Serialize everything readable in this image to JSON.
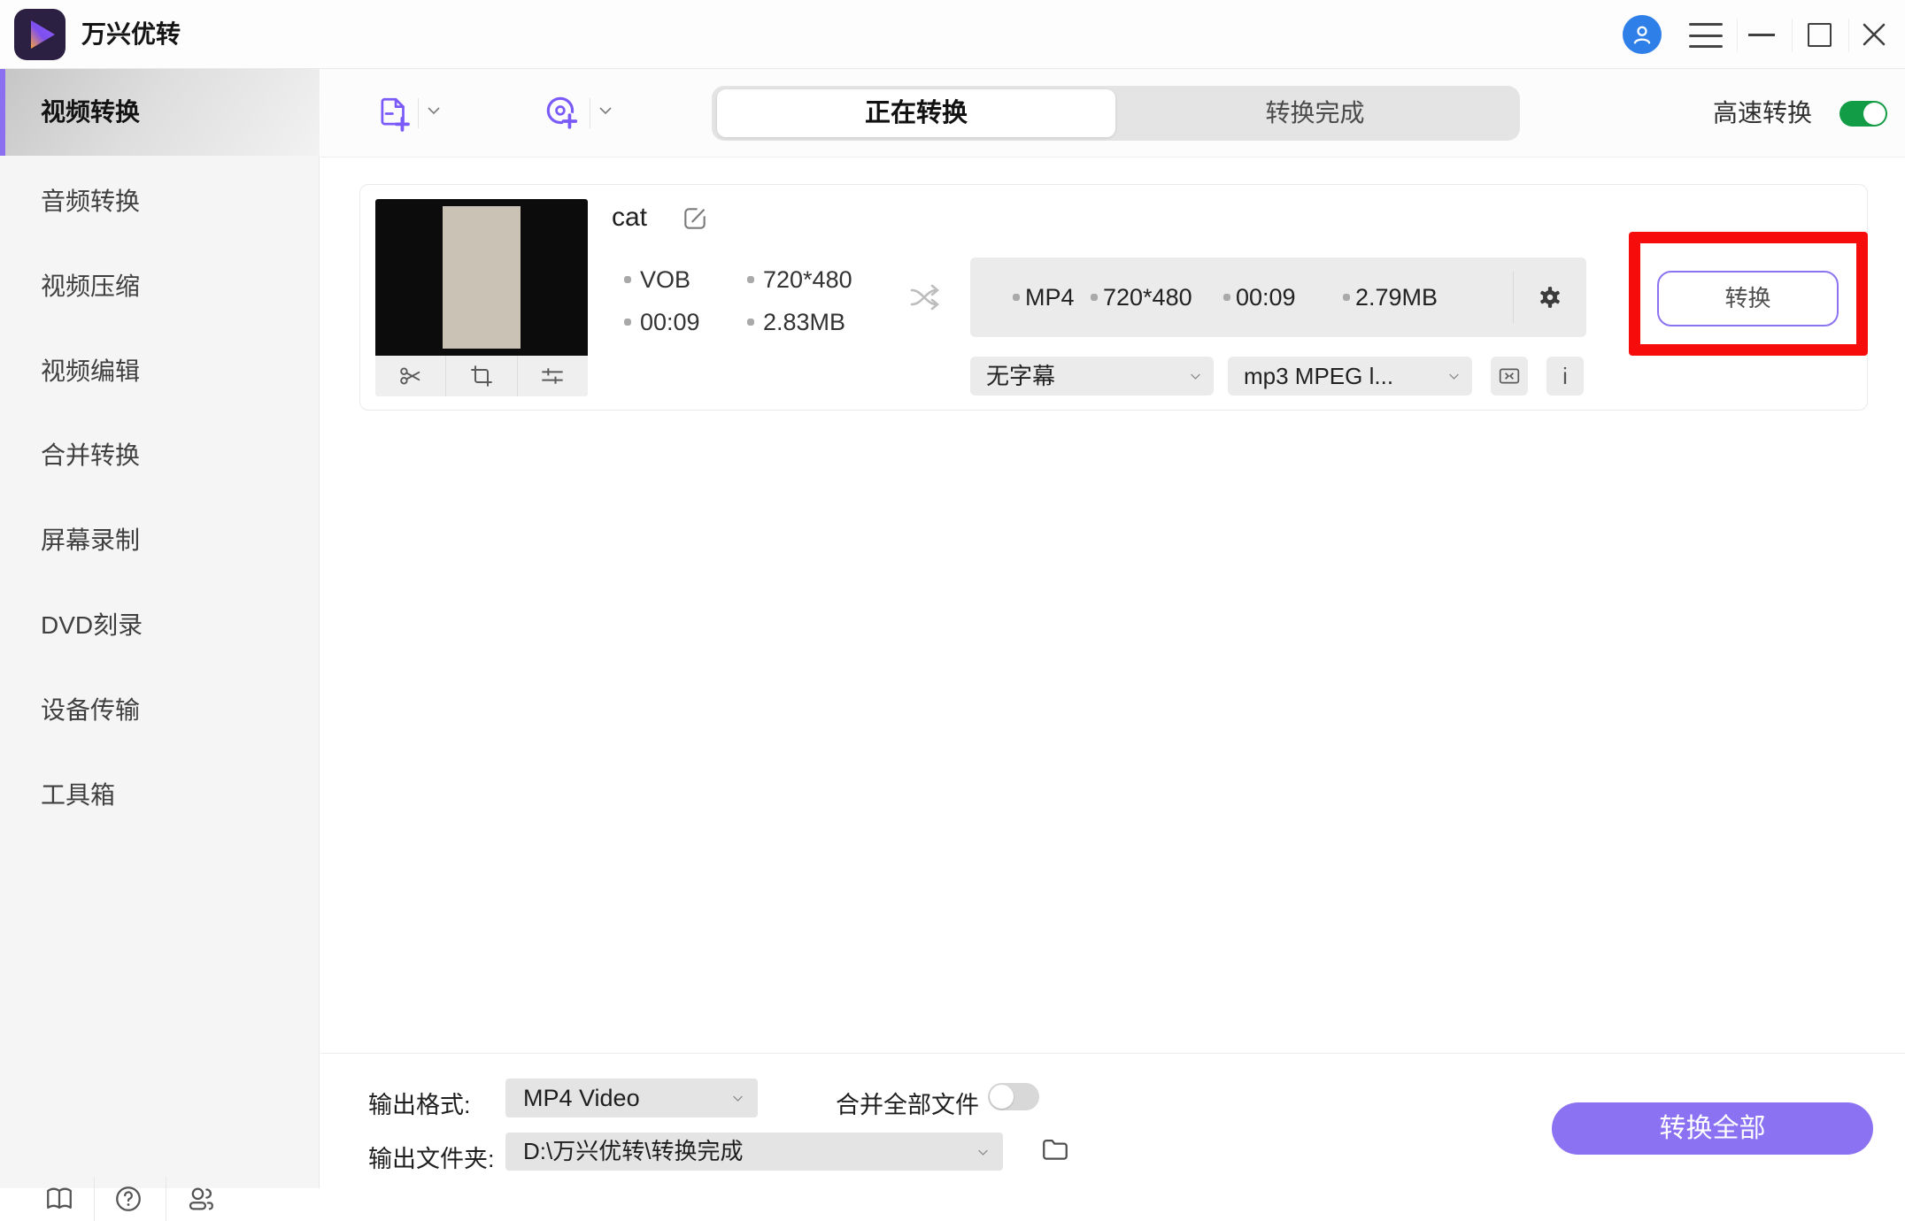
{
  "app": {
    "title": "万兴优转"
  },
  "sidebar": {
    "items": [
      {
        "label": "视频转换",
        "active": true
      },
      {
        "label": "音频转换"
      },
      {
        "label": "视频压缩"
      },
      {
        "label": "视频编辑"
      },
      {
        "label": "合并转换"
      },
      {
        "label": "屏幕录制"
      },
      {
        "label": "DVD刻录"
      },
      {
        "label": "设备传输"
      },
      {
        "label": "工具箱"
      }
    ]
  },
  "toolbar": {
    "tab_converting": "正在转换",
    "tab_finished": "转换完成",
    "high_speed_label": "高速转换",
    "high_speed_on": true
  },
  "task": {
    "name": "cat",
    "source": {
      "format": "VOB",
      "resolution": "720*480",
      "duration": "00:09",
      "size": "2.83MB"
    },
    "output": {
      "format": "MP4",
      "resolution": "720*480",
      "duration": "00:09",
      "size": "2.79MB"
    },
    "subtitle": "无字幕",
    "audio_track": "mp3 MPEG l...",
    "info_glyph": "i",
    "convert_label": "转换"
  },
  "footer": {
    "output_format_label": "输出格式:",
    "output_format_value": "MP4 Video",
    "merge_all_label": "合并全部文件",
    "merge_all_on": false,
    "output_folder_label": "输出文件夹:",
    "output_folder_value": "D:\\万兴优转\\转换完成",
    "convert_all_label": "转换全部"
  },
  "icons": {
    "logo": "play-triangle-gradient",
    "avatar": "person",
    "menu": "hamburger",
    "add_file": "document-plus",
    "add_disc": "disc-plus",
    "thumb_tools": [
      "scissors",
      "crop",
      "sliders"
    ],
    "rename": "pencil-square",
    "transfer": "shuffle-arrows",
    "settings": "gear",
    "trim": "compress-brackets",
    "info": "i",
    "footer_left": [
      "book",
      "help",
      "community"
    ],
    "folder": "folder"
  },
  "colors": {
    "accent_purple": "#8b72f2",
    "toggle_green": "#129c45",
    "toggle_off_gray": "#d8d8d9",
    "annotation_red": "#f70c0c",
    "avatar_blue": "#2e7fe8"
  }
}
